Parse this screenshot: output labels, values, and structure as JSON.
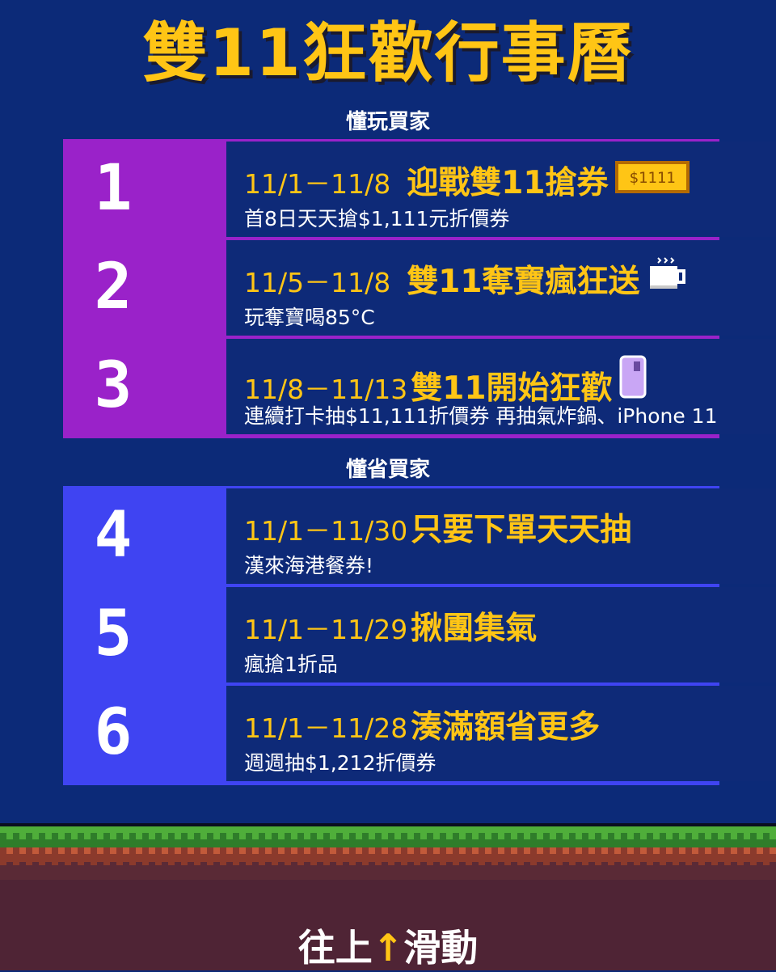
{
  "title": "雙11狂歡行事曆",
  "sections": [
    {
      "label": "懂玩買家",
      "color": "#9a22c9",
      "rows": [
        {
          "num": "1",
          "date": "11/1－11/8",
          "headline": "迎戰雙11搶券",
          "detail": "首8日天天搶$1,111元折價券",
          "icon": "coupon-1111-icon",
          "icon_text": "$1111"
        },
        {
          "num": "2",
          "date": "11/5－11/8",
          "headline": "雙11奪寶瘋狂送",
          "detail": "玩奪寶喝85°C",
          "icon": "coffee-cup-icon"
        },
        {
          "num": "3",
          "date": "11/8－11/13",
          "headline": "雙11開始狂歡",
          "detail": "連續打卡抽$11,111折價券 再抽氣炸鍋、iPhone 11",
          "icon": "phone-icon"
        }
      ]
    },
    {
      "label": "懂省買家",
      "color": "#3f44f2",
      "rows": [
        {
          "num": "4",
          "date": "11/1－11/30",
          "headline": "只要下單天天抽",
          "detail": "漢來海港餐券!"
        },
        {
          "num": "5",
          "date": "11/1－11/29",
          "headline": "揪團集氣",
          "detail": "瘋搶1折品"
        },
        {
          "num": "6",
          "date": "11/1－11/28",
          "headline": "湊滿額省更多",
          "detail": "週週抽$1,212折價券"
        }
      ]
    }
  ],
  "footer": {
    "prefix": "往上",
    "arrow": "↑",
    "suffix": "滑動",
    "arrow_icon": "up-arrow-icon"
  }
}
